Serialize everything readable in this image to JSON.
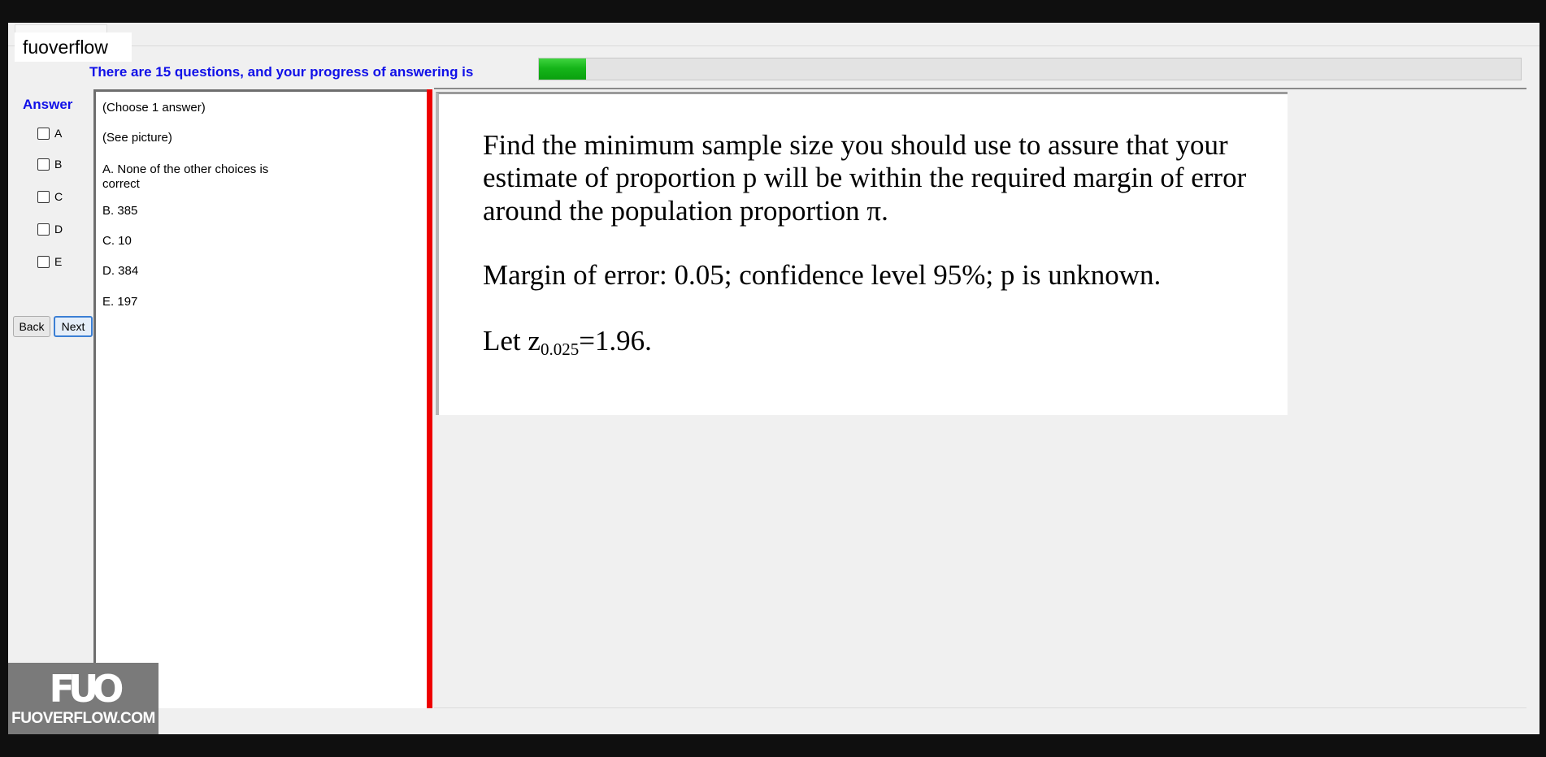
{
  "app": {
    "brand": "fuoverflow"
  },
  "progress": {
    "text": "There are 15 questions, and your progress of answering is",
    "fraction": 0.048
  },
  "answer": {
    "title": "Answer",
    "checkboxes": [
      {
        "label": "A",
        "checked": false
      },
      {
        "label": "B",
        "checked": false
      },
      {
        "label": "C",
        "checked": false
      },
      {
        "label": "D",
        "checked": false
      },
      {
        "label": "E",
        "checked": false
      }
    ]
  },
  "nav": {
    "back_label": "Back",
    "next_label": "Next"
  },
  "options": {
    "instruction": "(Choose 1 answer)",
    "see_picture": "(See picture)",
    "items": [
      {
        "letter": "A.",
        "text_line1": "None of the other choices is",
        "text_line2": "correct"
      },
      {
        "letter": "B.",
        "text_line1": "385"
      },
      {
        "letter": "C.",
        "text_line1": "10"
      },
      {
        "letter": "D.",
        "text_line1": "384"
      },
      {
        "letter": "E.",
        "text_line1": "197"
      }
    ]
  },
  "question": {
    "line1": "Find the minimum sample size you should use to assure that your",
    "line2": "estimate of proportion p will be within the required margin of error",
    "line3": "around the population proportion π.",
    "line4": "Margin of error: 0.05; confidence level 95%; p is unknown.",
    "let_prefix": "Let z",
    "let_subscript": "0.025",
    "let_suffix": "=1.96."
  },
  "watermark": {
    "logo": "FUO",
    "text": "FUOVERFLOW.COM"
  },
  "colors": {
    "accent_blue": "#1010e8",
    "progress_green": "#16b51a",
    "divider_red": "#ee0000"
  }
}
